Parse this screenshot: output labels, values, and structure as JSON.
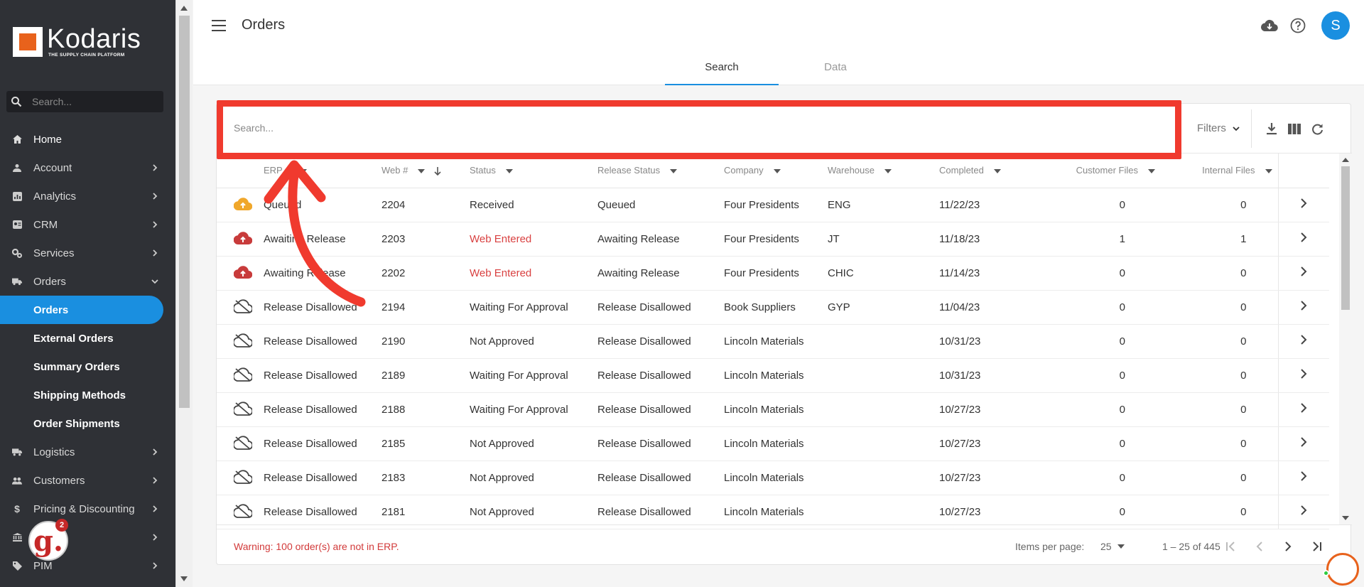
{
  "app": {
    "brand_name": "Kodaris",
    "brand_tagline": "THE SUPPLY CHAIN PLATFORM"
  },
  "sidebar": {
    "search_placeholder": "Search...",
    "items": [
      {
        "label": "Home",
        "icon": "home-icon",
        "chevron": false
      },
      {
        "label": "Account",
        "icon": "account-icon",
        "chevron": true
      },
      {
        "label": "Analytics",
        "icon": "analytics-icon",
        "chevron": true
      },
      {
        "label": "CRM",
        "icon": "crm-icon",
        "chevron": true
      },
      {
        "label": "Services",
        "icon": "services-icon",
        "chevron": true
      },
      {
        "label": "Orders",
        "icon": "truck-icon",
        "chevron": "down"
      }
    ],
    "sub_items": [
      {
        "label": "Orders",
        "active": true
      },
      {
        "label": "External Orders"
      },
      {
        "label": "Summary Orders"
      },
      {
        "label": "Shipping Methods"
      },
      {
        "label": "Order Shipments"
      }
    ],
    "items_after": [
      {
        "label": "Logistics",
        "icon": "logistics-icon"
      },
      {
        "label": "Customers",
        "icon": "customers-icon"
      },
      {
        "label": "Pricing & Discounting",
        "icon": "dollar-icon"
      },
      {
        "label": "",
        "icon": "bank-icon"
      },
      {
        "label": "PIM",
        "icon": "tag-icon"
      }
    ],
    "badge_count": "2"
  },
  "header": {
    "title": "Orders",
    "avatar_initial": "S",
    "tabs": [
      {
        "label": "Search",
        "active": true
      },
      {
        "label": "Data",
        "active": false
      }
    ]
  },
  "search": {
    "placeholder": "Search...",
    "filters_label": "Filters"
  },
  "table": {
    "columns": [
      "ERP #",
      "Web #",
      "Status",
      "Release Status",
      "Company",
      "Warehouse",
      "Completed",
      "Customer Files",
      "Internal Files"
    ],
    "rows": [
      {
        "icon": "cloud-upload-orange-icon",
        "erp": "Queued",
        "web": "2204",
        "status": "Received",
        "status_red": false,
        "release": "Queued",
        "company": "Four Presidents",
        "warehouse": "ENG",
        "completed": "11/22/23",
        "customer_files": "0",
        "internal_files": "0"
      },
      {
        "icon": "cloud-upload-red-icon",
        "erp": "Awaiting Release",
        "web": "2203",
        "status": "Web Entered",
        "status_red": true,
        "release": "Awaiting Release",
        "company": "Four Presidents",
        "warehouse": "JT",
        "completed": "11/18/23",
        "customer_files": "1",
        "internal_files": "1"
      },
      {
        "icon": "cloud-upload-red-icon",
        "erp": "Awaiting Release",
        "web": "2202",
        "status": "Web Entered",
        "status_red": true,
        "release": "Awaiting Release",
        "company": "Four Presidents",
        "warehouse": "CHIC",
        "completed": "11/14/23",
        "customer_files": "0",
        "internal_files": "0"
      },
      {
        "icon": "cloud-off-icon",
        "erp": "Release Disallowed",
        "web": "2194",
        "status": "Waiting For Approval",
        "status_red": false,
        "release": "Release Disallowed",
        "company": "Book Suppliers",
        "warehouse": "GYP",
        "completed": "11/04/23",
        "customer_files": "0",
        "internal_files": "0"
      },
      {
        "icon": "cloud-off-icon",
        "erp": "Release Disallowed",
        "web": "2190",
        "status": "Not Approved",
        "status_red": false,
        "release": "Release Disallowed",
        "company": "Lincoln Materials",
        "warehouse": "",
        "completed": "10/31/23",
        "customer_files": "0",
        "internal_files": "0"
      },
      {
        "icon": "cloud-off-icon",
        "erp": "Release Disallowed",
        "web": "2189",
        "status": "Waiting For Approval",
        "status_red": false,
        "release": "Release Disallowed",
        "company": "Lincoln Materials",
        "warehouse": "",
        "completed": "10/31/23",
        "customer_files": "0",
        "internal_files": "0"
      },
      {
        "icon": "cloud-off-icon",
        "erp": "Release Disallowed",
        "web": "2188",
        "status": "Waiting For Approval",
        "status_red": false,
        "release": "Release Disallowed",
        "company": "Lincoln Materials",
        "warehouse": "",
        "completed": "10/27/23",
        "customer_files": "0",
        "internal_files": "0"
      },
      {
        "icon": "cloud-off-icon",
        "erp": "Release Disallowed",
        "web": "2185",
        "status": "Not Approved",
        "status_red": false,
        "release": "Release Disallowed",
        "company": "Lincoln Materials",
        "warehouse": "",
        "completed": "10/27/23",
        "customer_files": "0",
        "internal_files": "0"
      },
      {
        "icon": "cloud-off-icon",
        "erp": "Release Disallowed",
        "web": "2183",
        "status": "Not Approved",
        "status_red": false,
        "release": "Release Disallowed",
        "company": "Lincoln Materials",
        "warehouse": "",
        "completed": "10/27/23",
        "customer_files": "0",
        "internal_files": "0"
      },
      {
        "icon": "cloud-off-icon",
        "erp": "Release Disallowed",
        "web": "2181",
        "status": "Not Approved",
        "status_red": false,
        "release": "Release Disallowed",
        "company": "Lincoln Materials",
        "warehouse": "",
        "completed": "10/27/23",
        "customer_files": "0",
        "internal_files": "0"
      }
    ]
  },
  "footer": {
    "warning": "Warning: 100 order(s) are not in ERP.",
    "items_per_page_label": "Items per page:",
    "items_per_page": "25",
    "range": "1 – 25 of 445"
  },
  "colors": {
    "accent": "#1a8fe0",
    "sidebar_bg": "#2f3136",
    "annotation_red": "#f03a2e",
    "warning_red": "#d23a3a",
    "brand_orange": "#e8621c"
  }
}
